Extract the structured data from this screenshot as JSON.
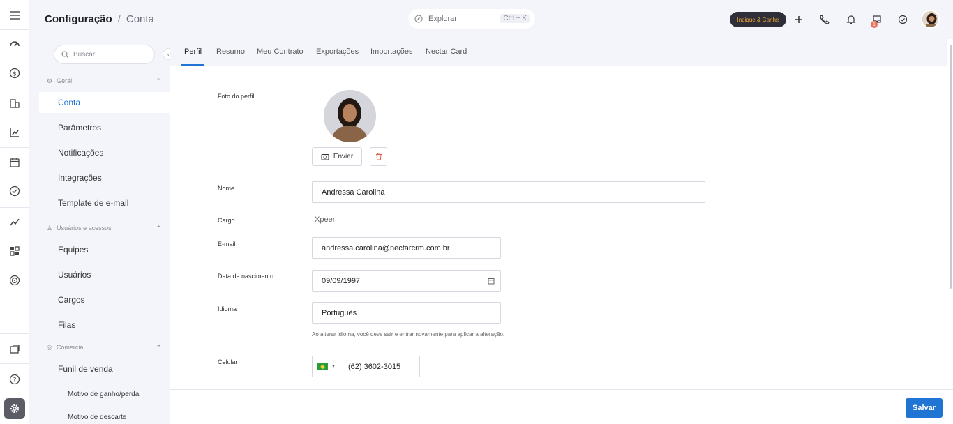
{
  "header": {
    "title": "Configuração",
    "subtitle": "Conta",
    "explore_placeholder": "Explorar",
    "explore_shortcut": "Ctrl + K",
    "indique_label": "Indique & Ganhe",
    "notification_count": "1"
  },
  "nav": {
    "search_placeholder": "Buscar",
    "sections": [
      {
        "label": "Geral",
        "items": [
          "Conta",
          "Parâmetros",
          "Notificações",
          "Integrações",
          "Template de e-mail"
        ]
      },
      {
        "label": "Usuários e acessos",
        "items": [
          "Equipes",
          "Usuários",
          "Cargos",
          "Filas"
        ]
      },
      {
        "label": "Comercial",
        "items": [
          "Funil de venda",
          "Motivo de ganho/perda",
          "Motivo de descarte"
        ]
      }
    ],
    "active_item": "Conta"
  },
  "tabs": [
    "Perfil",
    "Resumo",
    "Meu Contrato",
    "Exportações",
    "Importações",
    "Nectar Card"
  ],
  "active_tab": "Perfil",
  "profile": {
    "photo_label": "Foto do perfil",
    "send_label": "Enviar",
    "name_label": "Nome",
    "name_value": "Andressa Carolina",
    "role_label": "Cargo",
    "role_value": "Xpeer",
    "email_label": "E-mail",
    "email_value": "andressa.carolina@nectarcrm.com.br",
    "birth_label": "Data de nascimento",
    "birth_value": "09/09/1997",
    "language_label": "Idioma",
    "language_value": "Português",
    "language_hint": "Ao alterar idioma, você deve sair e entrar novamente para aplicar a alteração.",
    "phone_label": "Celular",
    "phone_value": "(62) 3602-3015"
  },
  "footer": {
    "save_label": "Salvar"
  },
  "colors": {
    "accent": "#1f74d4",
    "rail_active": "#5b5d66",
    "indique_bg": "#2e2f38",
    "indique_text": "#f0a63a"
  }
}
